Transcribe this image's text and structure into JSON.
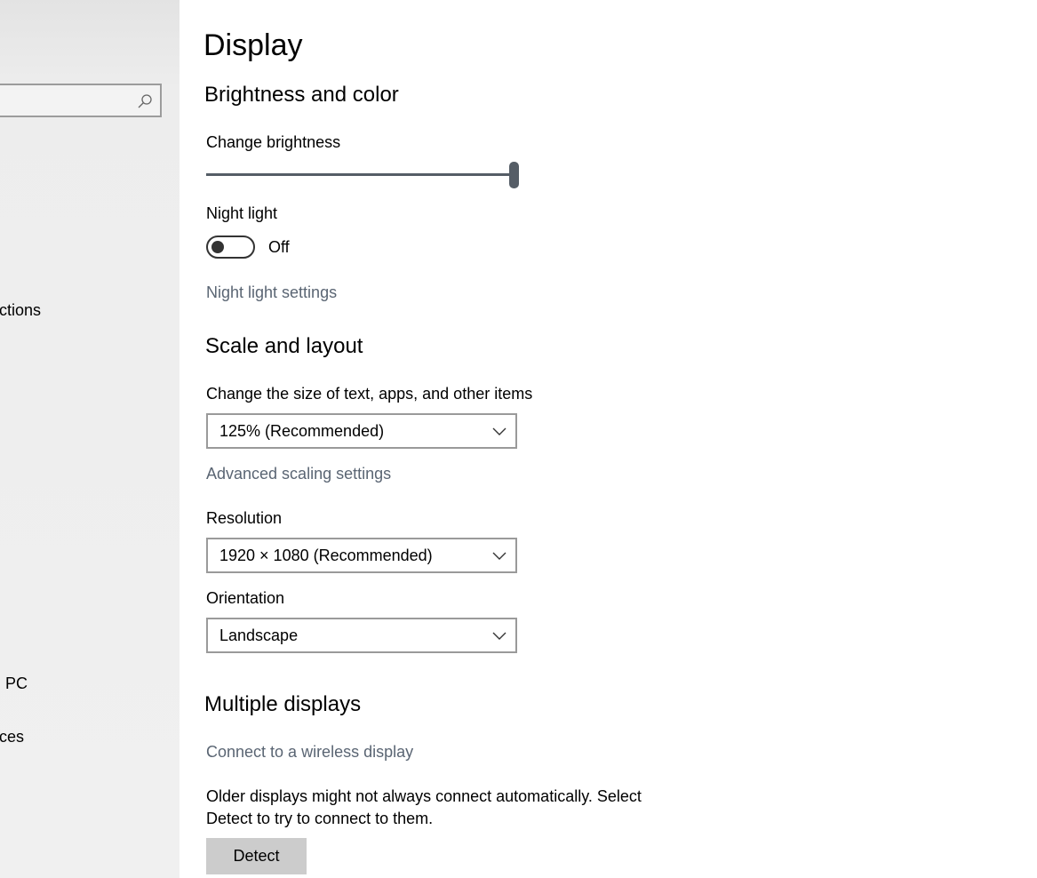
{
  "sidebar": {
    "search_placeholder": "",
    "items": [
      {
        "label": "ctions"
      },
      {
        "label": "PC"
      },
      {
        "label": "ces"
      }
    ]
  },
  "page": {
    "title": "Display"
  },
  "brightness": {
    "section_title": "Brightness and color",
    "label": "Change brightness",
    "value_percent": 100
  },
  "night_light": {
    "label": "Night light",
    "state": "Off",
    "settings_link": "Night light settings"
  },
  "scale": {
    "section_title": "Scale and layout",
    "size_label": "Change the size of text, apps, and other items",
    "size_value": "125% (Recommended)",
    "advanced_link": "Advanced scaling settings",
    "resolution_label": "Resolution",
    "resolution_value": "1920 × 1080 (Recommended)",
    "orientation_label": "Orientation",
    "orientation_value": "Landscape"
  },
  "multiple": {
    "section_title": "Multiple displays",
    "wireless_link": "Connect to a wireless display",
    "description": "Older displays might not always connect automatically. Select Detect to try to connect to them.",
    "detect_button": "Detect"
  },
  "colors": {
    "accent_text": "#5a6573",
    "slider": "#555d66",
    "button_bg": "#cccccc"
  }
}
